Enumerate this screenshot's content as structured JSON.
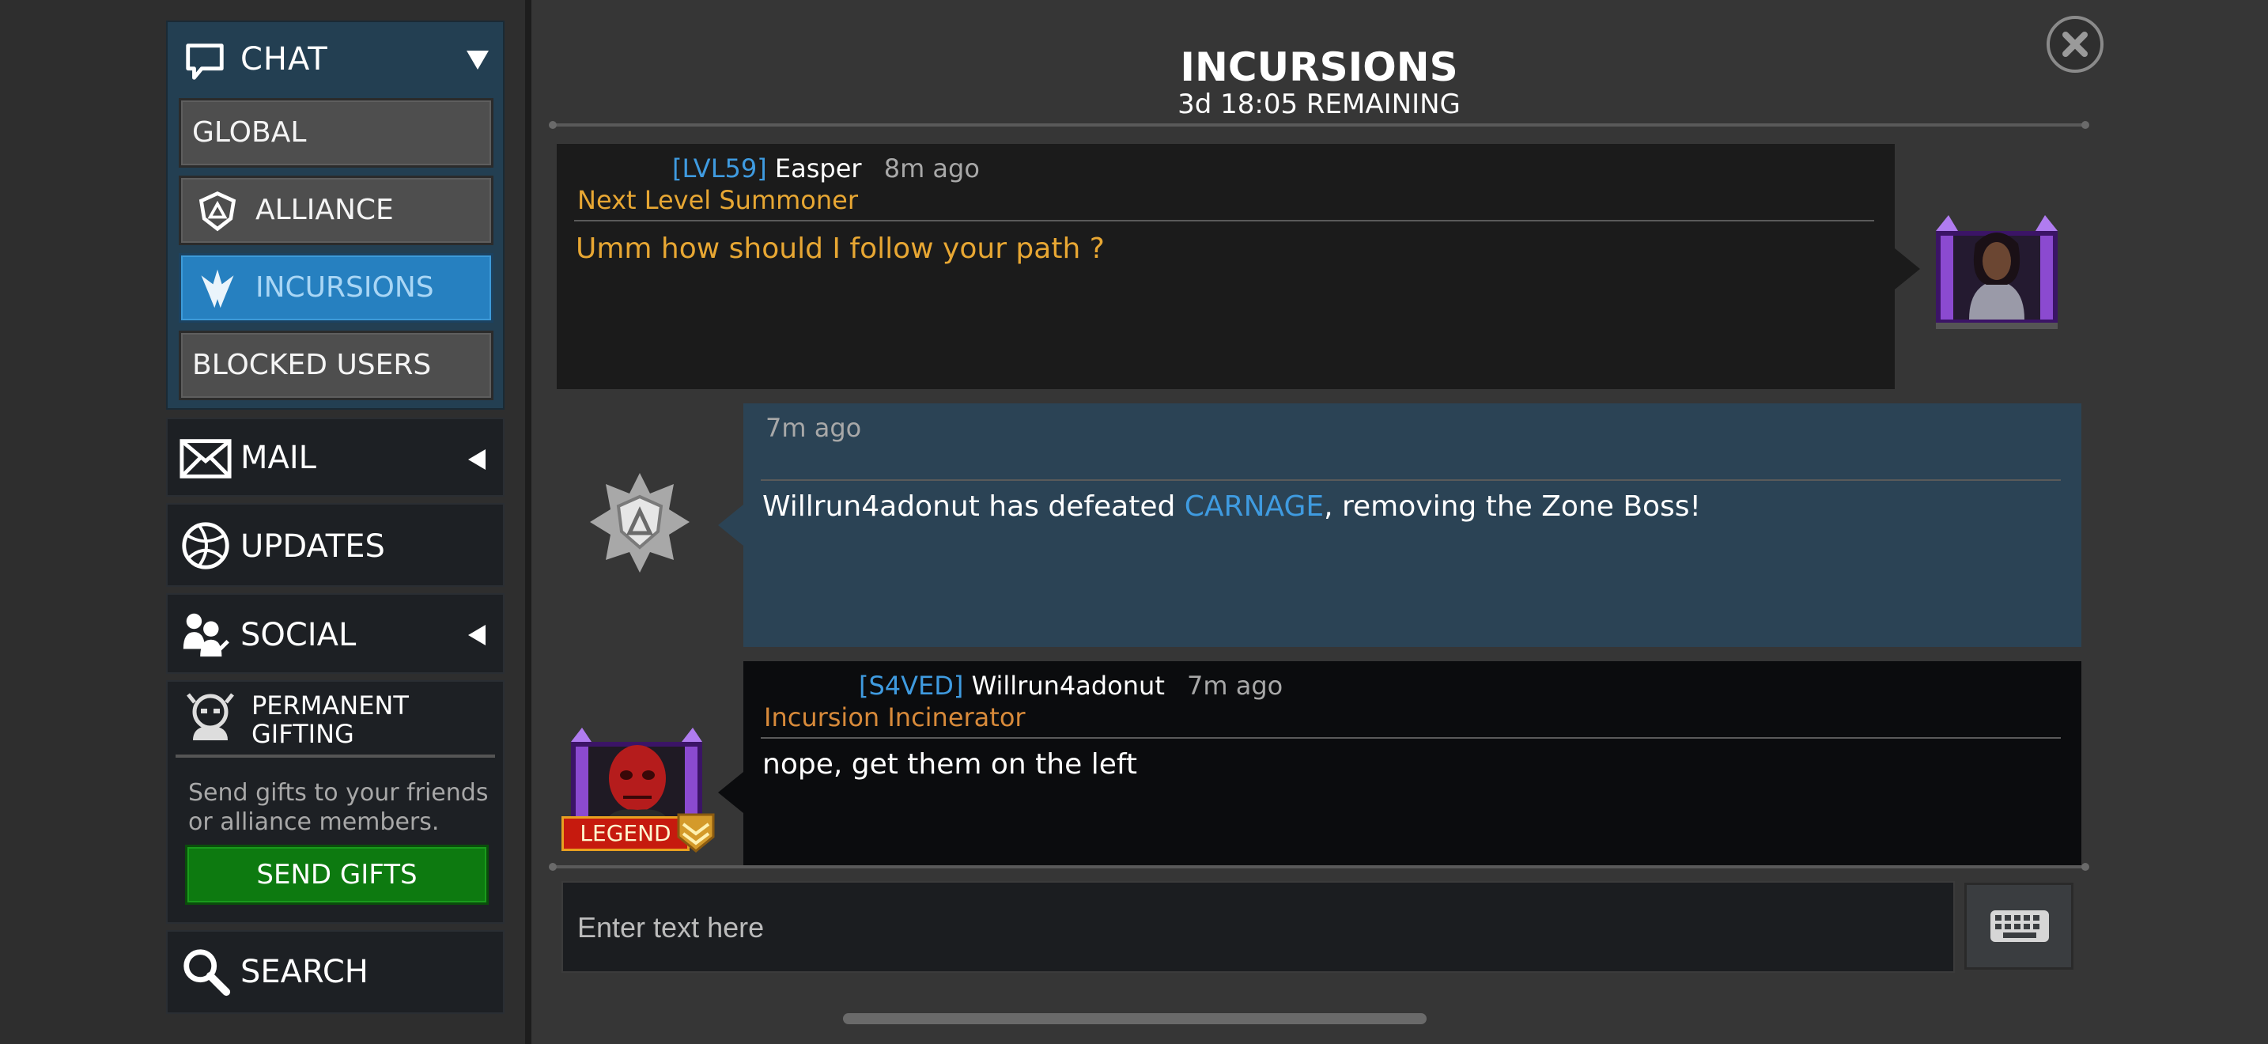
{
  "sidebar": {
    "chat": {
      "title": "CHAT",
      "items": [
        {
          "label": "GLOBAL",
          "icon": null,
          "active": false
        },
        {
          "label": "ALLIANCE",
          "icon": "shield-icon",
          "active": false
        },
        {
          "label": "INCURSIONS",
          "icon": "incursion-icon",
          "active": true
        },
        {
          "label": "BLOCKED USERS",
          "icon": null,
          "active": false
        }
      ]
    },
    "mail": {
      "label": "MAIL"
    },
    "updates": {
      "label": "UPDATES"
    },
    "social": {
      "label": "SOCIAL"
    },
    "gifting": {
      "title_line1": "PERMANENT",
      "title_line2": "GIFTING",
      "desc_line1": "Send gifts to your friends",
      "desc_line2": "or alliance members.",
      "button": "SEND GIFTS"
    },
    "search": {
      "label": "SEARCH"
    }
  },
  "header": {
    "title": "INCURSIONS",
    "subtitle": "3d 18:05 REMAINING"
  },
  "messages": [
    {
      "tag": "[LVL59]",
      "user": "Easper",
      "time": "8m ago",
      "title": "Next Level Summoner",
      "text": "Umm how should I follow your path ?"
    },
    {
      "time": "7m ago",
      "text_before": "Willrun4adonut has defeated ",
      "highlight": "CARNAGE",
      "text_after": ", removing the Zone Boss!"
    },
    {
      "tag": "[S4VED]",
      "user": "Willrun4adonut",
      "time": "7m ago",
      "title": "Incursion Incinerator",
      "text": "nope, get them on the left",
      "badge": "LEGEND"
    }
  ],
  "input": {
    "placeholder": "Enter text here"
  },
  "colors": {
    "active_tab": "#2680c0",
    "tag_blue": "#3f9be0",
    "title_gold": "#e8a733",
    "title_orange": "#d88a3a",
    "system_panel": "#2b4355",
    "send_green": "#0d7a10"
  }
}
